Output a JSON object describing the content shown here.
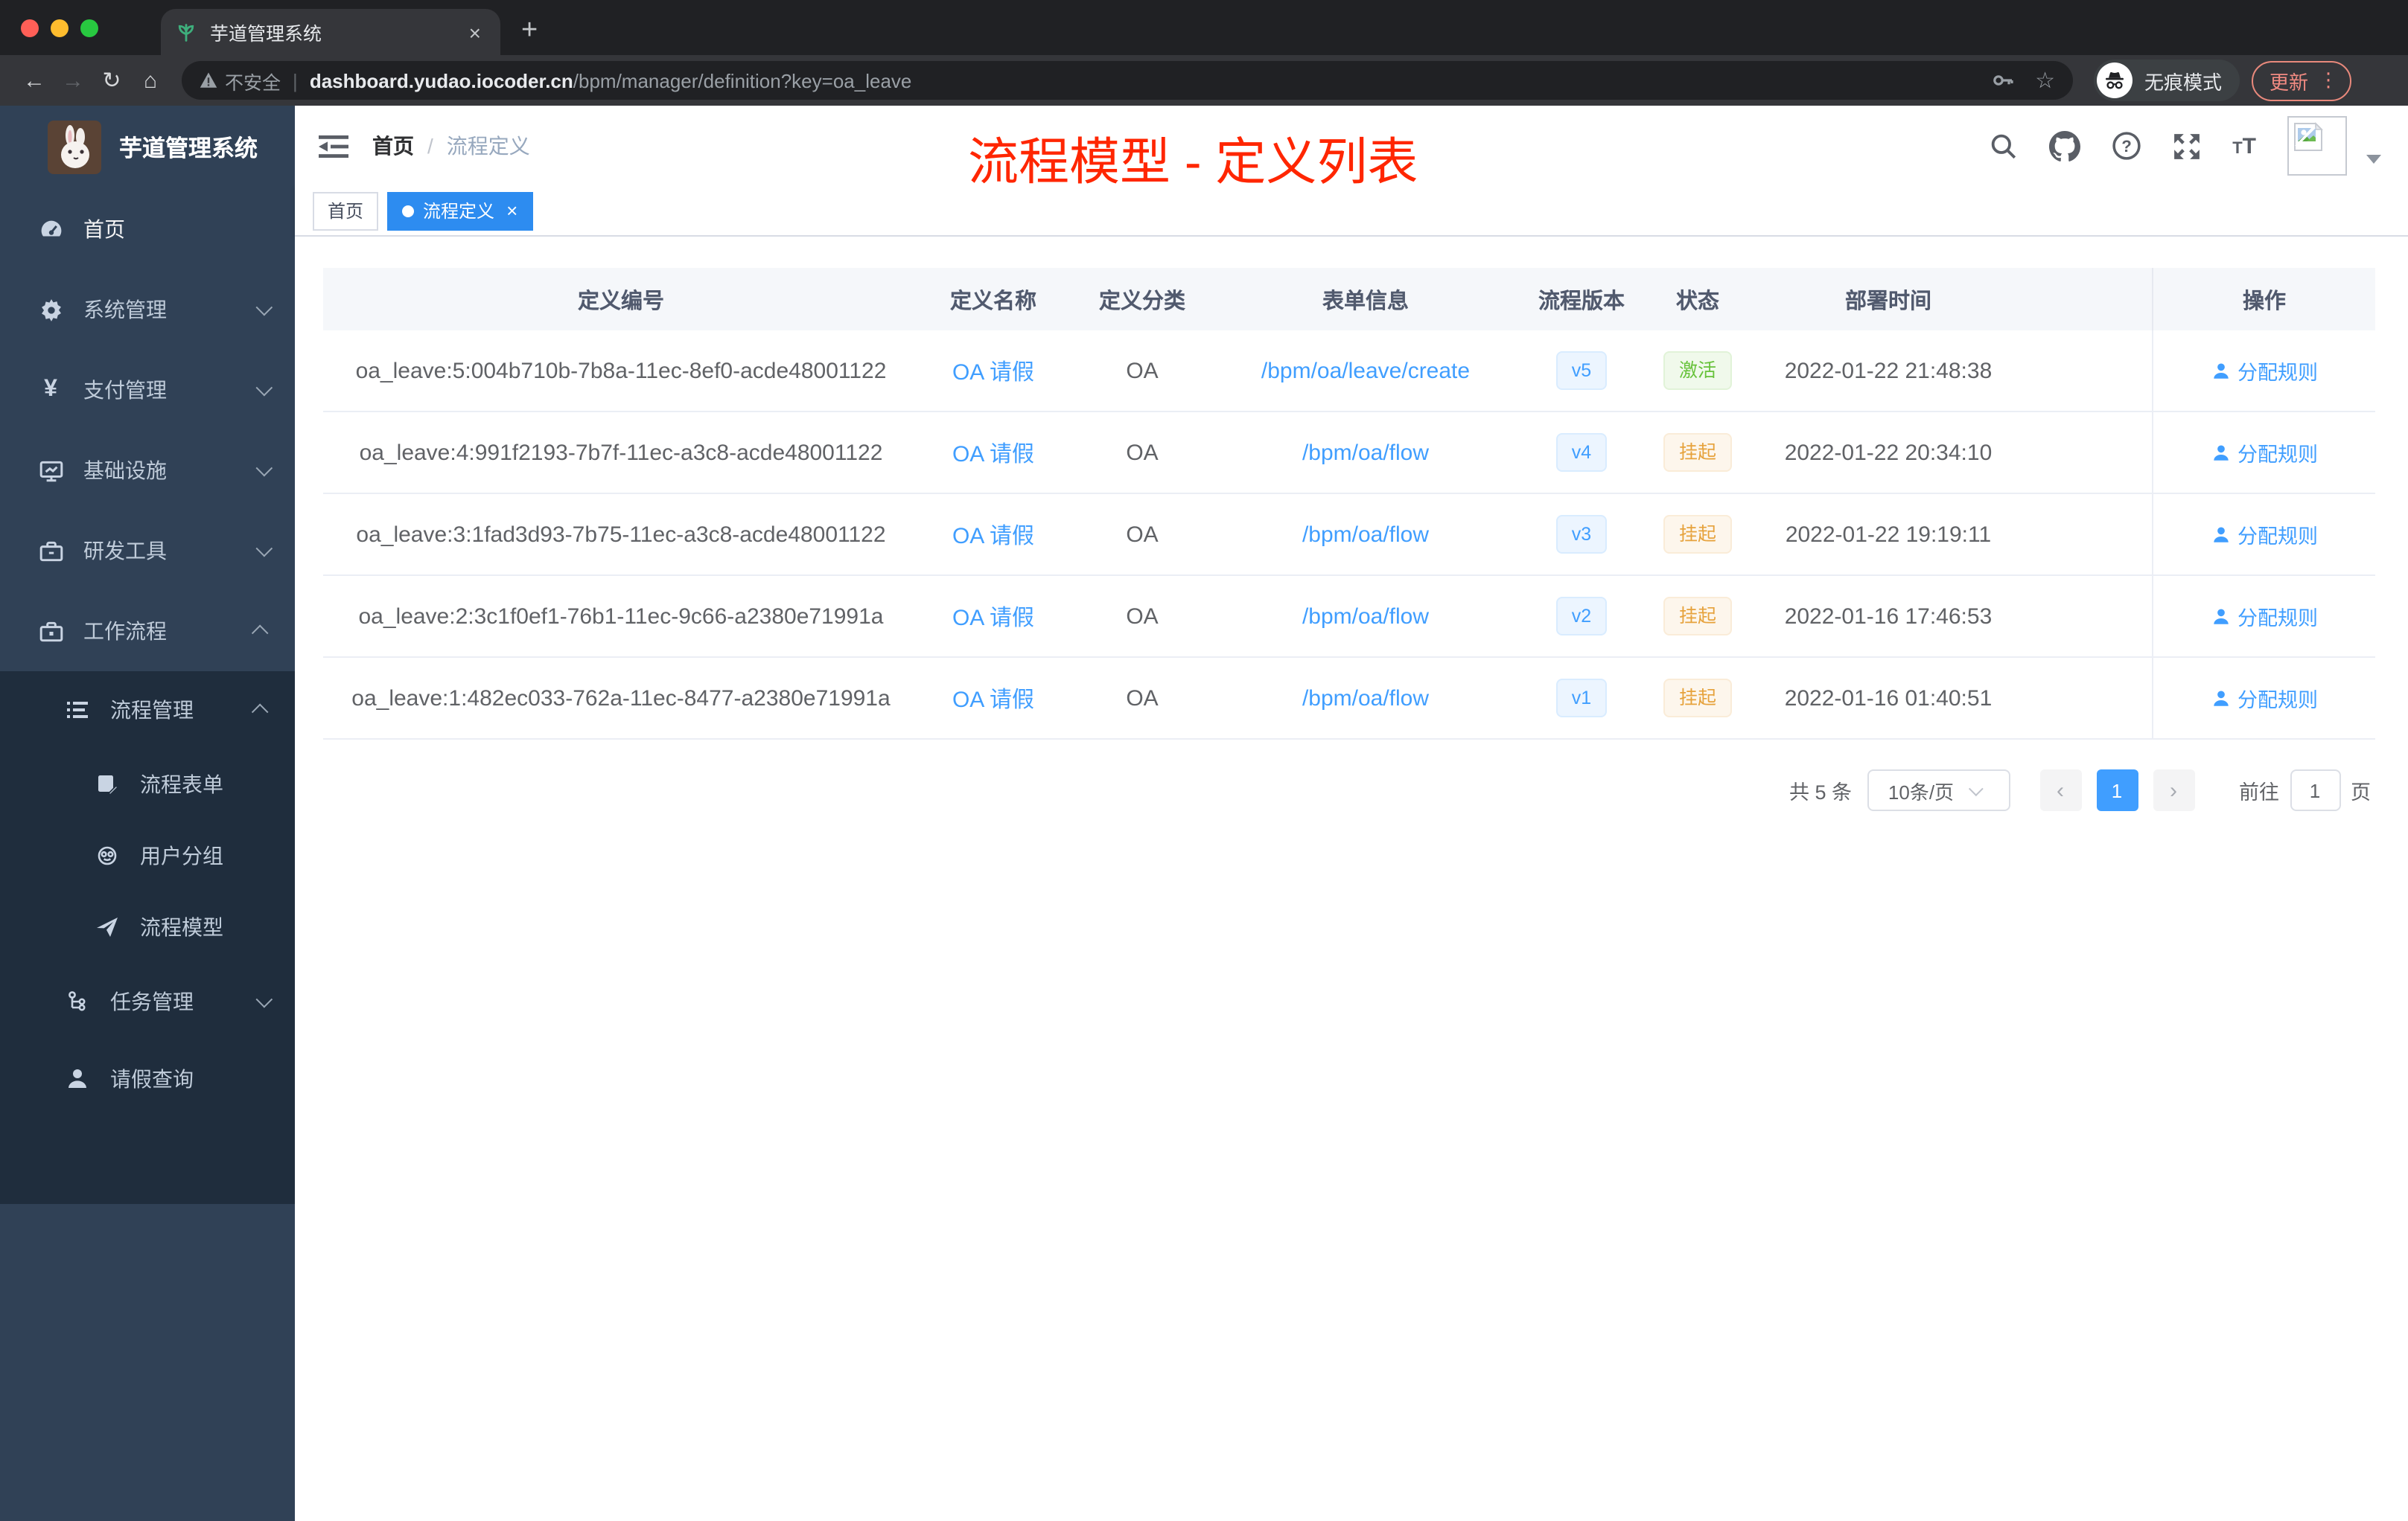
{
  "colors": {
    "accent": "#409eff",
    "success": "#67c23a",
    "warning": "#e6a23c",
    "annotation_red": "#ff2600",
    "sidebar_bg": "#304156",
    "submenu_bg": "#1f2d3d",
    "active_tag_blue": "#2d8cf0"
  },
  "browser": {
    "tab_title": "芋道管理系统",
    "close_tab": "×",
    "new_tab_button": "+",
    "back": "←",
    "forward": "→",
    "reload": "↻",
    "home": "⌂",
    "security_label": "不安全",
    "url_host": "dashboard.yudao.iocoder.cn",
    "url_path": "/bpm/manager/definition?key=oa_leave",
    "star": "☆",
    "incognito_label": "无痕模式",
    "update_button": "更新",
    "kebab": "⋮"
  },
  "sidebar": {
    "app_title": "芋道管理系统",
    "items": [
      {
        "label": "首页"
      },
      {
        "label": "系统管理"
      },
      {
        "label": "支付管理"
      },
      {
        "label": "基础设施"
      },
      {
        "label": "研发工具"
      },
      {
        "label": "工作流程"
      },
      {
        "label": "流程管理"
      },
      {
        "label": "流程表单"
      },
      {
        "label": "用户分组"
      },
      {
        "label": "流程模型"
      },
      {
        "label": "任务管理"
      },
      {
        "label": "请假查询"
      }
    ]
  },
  "navbar": {
    "breadcrumb": [
      "首页",
      "流程定义"
    ],
    "separator": "/",
    "annotation": "流程模型 - 定义列表"
  },
  "tags": [
    {
      "label": "首页"
    },
    {
      "label": "流程定义",
      "close": "×"
    }
  ],
  "table": {
    "columns": [
      "定义编号",
      "定义名称",
      "定义分类",
      "表单信息",
      "流程版本",
      "状态",
      "部署时间",
      "操作"
    ],
    "rows": [
      {
        "id": "oa_leave:5:004b710b-7b8a-11ec-8ef0-acde48001122",
        "name": "OA 请假",
        "category": "OA",
        "form": "/bpm/oa/leave/create",
        "version": "v5",
        "status": "激活",
        "deployed": "2022-01-22 21:48:38",
        "action": "分配规则"
      },
      {
        "id": "oa_leave:4:991f2193-7b7f-11ec-a3c8-acde48001122",
        "name": "OA 请假",
        "category": "OA",
        "form": "/bpm/oa/flow",
        "version": "v4",
        "status": "挂起",
        "deployed": "2022-01-22 20:34:10",
        "action": "分配规则"
      },
      {
        "id": "oa_leave:3:1fad3d93-7b75-11ec-a3c8-acde48001122",
        "name": "OA 请假",
        "category": "OA",
        "form": "/bpm/oa/flow",
        "version": "v3",
        "status": "挂起",
        "deployed": "2022-01-22 19:19:11",
        "action": "分配规则"
      },
      {
        "id": "oa_leave:2:3c1f0ef1-76b1-11ec-9c66-a2380e71991a",
        "name": "OA 请假",
        "category": "OA",
        "form": "/bpm/oa/flow",
        "version": "v2",
        "status": "挂起",
        "deployed": "2022-01-16 17:46:53",
        "action": "分配规则"
      },
      {
        "id": "oa_leave:1:482ec033-762a-11ec-8477-a2380e71991a",
        "name": "OA 请假",
        "category": "OA",
        "form": "/bpm/oa/flow",
        "version": "v1",
        "status": "挂起",
        "deployed": "2022-01-16 01:40:51",
        "action": "分配规则"
      }
    ]
  },
  "pagination": {
    "total": "共 5 条",
    "page_size": "10条/页",
    "prev": "‹",
    "page": "1",
    "next": "›",
    "goto_label": "前往",
    "goto_value": "1",
    "goto_unit": "页"
  }
}
